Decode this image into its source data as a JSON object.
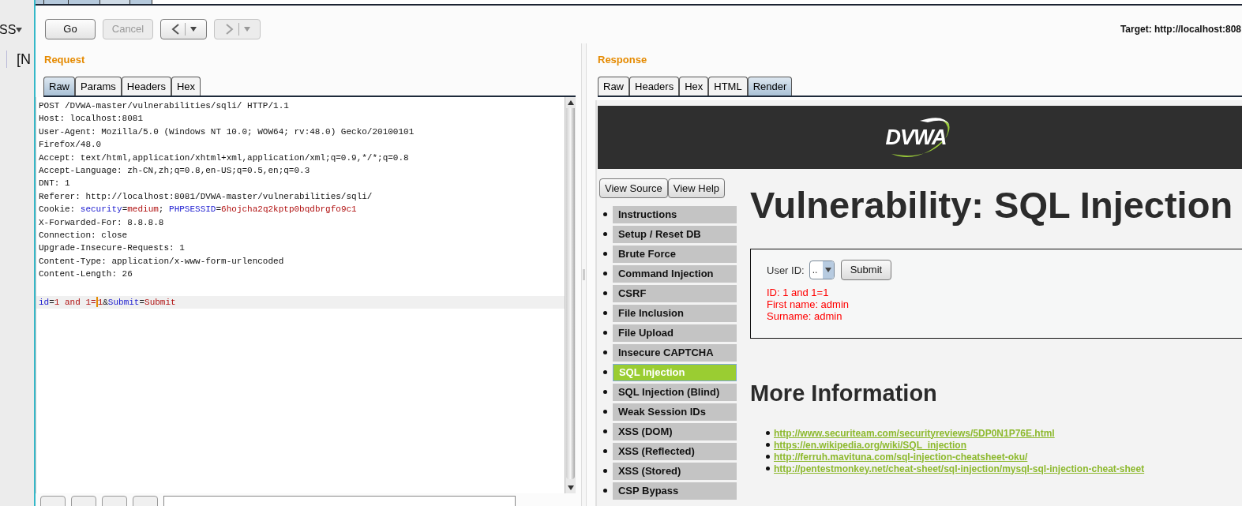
{
  "background_app": {
    "menu_label": "SS",
    "bracket_text": "[N"
  },
  "toolbar": {
    "buttons": [
      {
        "kind": "text",
        "label": "Go",
        "disabled": false
      },
      {
        "kind": "text",
        "label": "Cancel",
        "disabled": true
      },
      {
        "kind": "back",
        "disabled": false
      },
      {
        "kind": "forward",
        "disabled": true
      }
    ],
    "target": "Target: http://localhost:808"
  },
  "request": {
    "title": "Request",
    "tabs": [
      {
        "label": "Raw",
        "selected": true
      },
      {
        "label": "Params",
        "selected": false
      },
      {
        "label": "Headers",
        "selected": false
      },
      {
        "label": "Hex",
        "selected": false
      }
    ],
    "lines": [
      {
        "current": false,
        "segments": [
          {
            "kind": "plain",
            "text": "POST /DVWA-master/vulnerabilities/sqli/ HTTP/1.1"
          }
        ]
      },
      {
        "current": false,
        "segments": [
          {
            "kind": "plain",
            "text": "Host: localhost:8081"
          }
        ]
      },
      {
        "current": false,
        "segments": [
          {
            "kind": "plain",
            "text": "User-Agent: Mozilla/5.0 (Windows NT 10.0; WOW64; rv:48.0) Gecko/20100101"
          }
        ]
      },
      {
        "current": false,
        "segments": [
          {
            "kind": "plain",
            "text": "Firefox/48.0"
          }
        ]
      },
      {
        "current": false,
        "segments": [
          {
            "kind": "plain",
            "text": "Accept: text/html,application/xhtml+xml,application/xml;q=0.9,*/*;q=0.8"
          }
        ]
      },
      {
        "current": false,
        "segments": [
          {
            "kind": "plain",
            "text": "Accept-Language: zh-CN,zh;q=0.8,en-US;q=0.5,en;q=0.3"
          }
        ]
      },
      {
        "current": false,
        "segments": [
          {
            "kind": "plain",
            "text": "DNT: 1"
          }
        ]
      },
      {
        "current": false,
        "segments": [
          {
            "kind": "plain",
            "text": "Referer: http://localhost:8081/DVWA-master/vulnerabilities/sqli/"
          }
        ]
      },
      {
        "current": false,
        "segments": [
          {
            "kind": "plain",
            "text": "Cookie: "
          },
          {
            "kind": "name",
            "text": "security"
          },
          {
            "kind": "plain",
            "text": "="
          },
          {
            "kind": "value",
            "text": "medium"
          },
          {
            "kind": "plain",
            "text": "; "
          },
          {
            "kind": "name",
            "text": "PHPSESSID"
          },
          {
            "kind": "plain",
            "text": "="
          },
          {
            "kind": "value",
            "text": "6hojcha2q2kptp0bqdbrgfo9c1"
          }
        ]
      },
      {
        "current": false,
        "segments": [
          {
            "kind": "plain",
            "text": "X-Forwarded-For: 8.8.8.8"
          }
        ]
      },
      {
        "current": false,
        "segments": [
          {
            "kind": "plain",
            "text": "Connection: close"
          }
        ]
      },
      {
        "current": false,
        "segments": [
          {
            "kind": "plain",
            "text": "Upgrade-Insecure-Requests: 1"
          }
        ]
      },
      {
        "current": false,
        "segments": [
          {
            "kind": "plain",
            "text": "Content-Type: application/x-www-form-urlencoded"
          }
        ]
      },
      {
        "current": false,
        "segments": [
          {
            "kind": "plain",
            "text": "Content-Length: 26"
          }
        ]
      },
      {
        "current": false
      },
      {
        "current": true,
        "segments": [
          {
            "kind": "name",
            "text": "id"
          },
          {
            "kind": "plain",
            "text": "="
          },
          {
            "kind": "value",
            "text": "1 and 1="
          },
          {
            "kind": "cursor"
          },
          {
            "kind": "value",
            "text": "1"
          },
          {
            "kind": "plain",
            "text": "&"
          },
          {
            "kind": "name",
            "text": "Submit"
          },
          {
            "kind": "plain",
            "text": "="
          },
          {
            "kind": "value",
            "text": "Submit"
          }
        ]
      }
    ]
  },
  "response": {
    "title": "Response",
    "tabs": [
      {
        "label": "Raw",
        "selected": false
      },
      {
        "label": "Headers",
        "selected": false
      },
      {
        "label": "Hex",
        "selected": false
      },
      {
        "label": "HTML",
        "selected": false
      },
      {
        "label": "Render",
        "selected": true
      }
    ],
    "page": {
      "logo_text": "DVWA",
      "source_buttons": [
        "View Source",
        "View Help"
      ],
      "menu": [
        {
          "label": "Instructions",
          "selected": false
        },
        {
          "label": "Setup / Reset DB",
          "selected": false
        },
        {
          "label": "Brute Force",
          "selected": false
        },
        {
          "label": "Command Injection",
          "selected": false
        },
        {
          "label": "CSRF",
          "selected": false
        },
        {
          "label": "File Inclusion",
          "selected": false
        },
        {
          "label": "File Upload",
          "selected": false
        },
        {
          "label": "Insecure CAPTCHA",
          "selected": false
        },
        {
          "label": "SQL Injection",
          "selected": true
        },
        {
          "label": "SQL Injection (Blind)",
          "selected": false
        },
        {
          "label": "Weak Session IDs",
          "selected": false
        },
        {
          "label": "XSS (DOM)",
          "selected": false
        },
        {
          "label": "XSS (Reflected)",
          "selected": false
        },
        {
          "label": "XSS (Stored)",
          "selected": false
        },
        {
          "label": "CSP Bypass",
          "selected": false
        }
      ],
      "heading": "Vulnerability: SQL Injection",
      "form": {
        "label": "User ID:",
        "select_value": "..",
        "submit": "Submit",
        "results": [
          "ID: 1 and 1=1",
          "First name: admin",
          "Surname: admin"
        ]
      },
      "more_heading": "More Information",
      "links": [
        "http://www.securiteam.com/securityreviews/5DP0N1P76E.html",
        "https://en.wikipedia.org/wiki/SQL_injection",
        "http://ferruh.mavituna.com/sql-injection-cheatsheet-oku/",
        "http://pentestmonkey.net/cheat-sheet/sql-injection/mysql-sql-injection-cheat-sheet"
      ]
    }
  }
}
